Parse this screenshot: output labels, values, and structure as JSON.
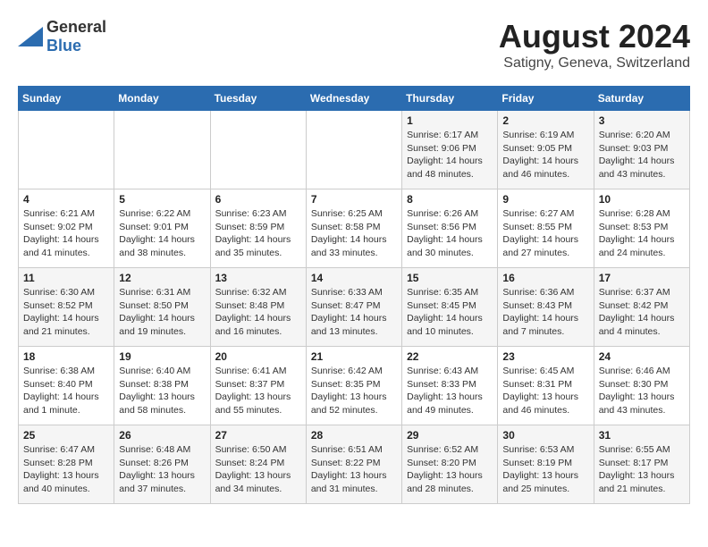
{
  "logo": {
    "text_general": "General",
    "text_blue": "Blue"
  },
  "header": {
    "month_year": "August 2024",
    "location": "Satigny, Geneva, Switzerland"
  },
  "days_of_week": [
    "Sunday",
    "Monday",
    "Tuesday",
    "Wednesday",
    "Thursday",
    "Friday",
    "Saturday"
  ],
  "weeks": [
    [
      {
        "day": "",
        "info": ""
      },
      {
        "day": "",
        "info": ""
      },
      {
        "day": "",
        "info": ""
      },
      {
        "day": "",
        "info": ""
      },
      {
        "day": "1",
        "info": "Sunrise: 6:17 AM\nSunset: 9:06 PM\nDaylight: 14 hours\nand 48 minutes."
      },
      {
        "day": "2",
        "info": "Sunrise: 6:19 AM\nSunset: 9:05 PM\nDaylight: 14 hours\nand 46 minutes."
      },
      {
        "day": "3",
        "info": "Sunrise: 6:20 AM\nSunset: 9:03 PM\nDaylight: 14 hours\nand 43 minutes."
      }
    ],
    [
      {
        "day": "4",
        "info": "Sunrise: 6:21 AM\nSunset: 9:02 PM\nDaylight: 14 hours\nand 41 minutes."
      },
      {
        "day": "5",
        "info": "Sunrise: 6:22 AM\nSunset: 9:01 PM\nDaylight: 14 hours\nand 38 minutes."
      },
      {
        "day": "6",
        "info": "Sunrise: 6:23 AM\nSunset: 8:59 PM\nDaylight: 14 hours\nand 35 minutes."
      },
      {
        "day": "7",
        "info": "Sunrise: 6:25 AM\nSunset: 8:58 PM\nDaylight: 14 hours\nand 33 minutes."
      },
      {
        "day": "8",
        "info": "Sunrise: 6:26 AM\nSunset: 8:56 PM\nDaylight: 14 hours\nand 30 minutes."
      },
      {
        "day": "9",
        "info": "Sunrise: 6:27 AM\nSunset: 8:55 PM\nDaylight: 14 hours\nand 27 minutes."
      },
      {
        "day": "10",
        "info": "Sunrise: 6:28 AM\nSunset: 8:53 PM\nDaylight: 14 hours\nand 24 minutes."
      }
    ],
    [
      {
        "day": "11",
        "info": "Sunrise: 6:30 AM\nSunset: 8:52 PM\nDaylight: 14 hours\nand 21 minutes."
      },
      {
        "day": "12",
        "info": "Sunrise: 6:31 AM\nSunset: 8:50 PM\nDaylight: 14 hours\nand 19 minutes."
      },
      {
        "day": "13",
        "info": "Sunrise: 6:32 AM\nSunset: 8:48 PM\nDaylight: 14 hours\nand 16 minutes."
      },
      {
        "day": "14",
        "info": "Sunrise: 6:33 AM\nSunset: 8:47 PM\nDaylight: 14 hours\nand 13 minutes."
      },
      {
        "day": "15",
        "info": "Sunrise: 6:35 AM\nSunset: 8:45 PM\nDaylight: 14 hours\nand 10 minutes."
      },
      {
        "day": "16",
        "info": "Sunrise: 6:36 AM\nSunset: 8:43 PM\nDaylight: 14 hours\nand 7 minutes."
      },
      {
        "day": "17",
        "info": "Sunrise: 6:37 AM\nSunset: 8:42 PM\nDaylight: 14 hours\nand 4 minutes."
      }
    ],
    [
      {
        "day": "18",
        "info": "Sunrise: 6:38 AM\nSunset: 8:40 PM\nDaylight: 14 hours\nand 1 minute."
      },
      {
        "day": "19",
        "info": "Sunrise: 6:40 AM\nSunset: 8:38 PM\nDaylight: 13 hours\nand 58 minutes."
      },
      {
        "day": "20",
        "info": "Sunrise: 6:41 AM\nSunset: 8:37 PM\nDaylight: 13 hours\nand 55 minutes."
      },
      {
        "day": "21",
        "info": "Sunrise: 6:42 AM\nSunset: 8:35 PM\nDaylight: 13 hours\nand 52 minutes."
      },
      {
        "day": "22",
        "info": "Sunrise: 6:43 AM\nSunset: 8:33 PM\nDaylight: 13 hours\nand 49 minutes."
      },
      {
        "day": "23",
        "info": "Sunrise: 6:45 AM\nSunset: 8:31 PM\nDaylight: 13 hours\nand 46 minutes."
      },
      {
        "day": "24",
        "info": "Sunrise: 6:46 AM\nSunset: 8:30 PM\nDaylight: 13 hours\nand 43 minutes."
      }
    ],
    [
      {
        "day": "25",
        "info": "Sunrise: 6:47 AM\nSunset: 8:28 PM\nDaylight: 13 hours\nand 40 minutes."
      },
      {
        "day": "26",
        "info": "Sunrise: 6:48 AM\nSunset: 8:26 PM\nDaylight: 13 hours\nand 37 minutes."
      },
      {
        "day": "27",
        "info": "Sunrise: 6:50 AM\nSunset: 8:24 PM\nDaylight: 13 hours\nand 34 minutes."
      },
      {
        "day": "28",
        "info": "Sunrise: 6:51 AM\nSunset: 8:22 PM\nDaylight: 13 hours\nand 31 minutes."
      },
      {
        "day": "29",
        "info": "Sunrise: 6:52 AM\nSunset: 8:20 PM\nDaylight: 13 hours\nand 28 minutes."
      },
      {
        "day": "30",
        "info": "Sunrise: 6:53 AM\nSunset: 8:19 PM\nDaylight: 13 hours\nand 25 minutes."
      },
      {
        "day": "31",
        "info": "Sunrise: 6:55 AM\nSunset: 8:17 PM\nDaylight: 13 hours\nand 21 minutes."
      }
    ]
  ]
}
